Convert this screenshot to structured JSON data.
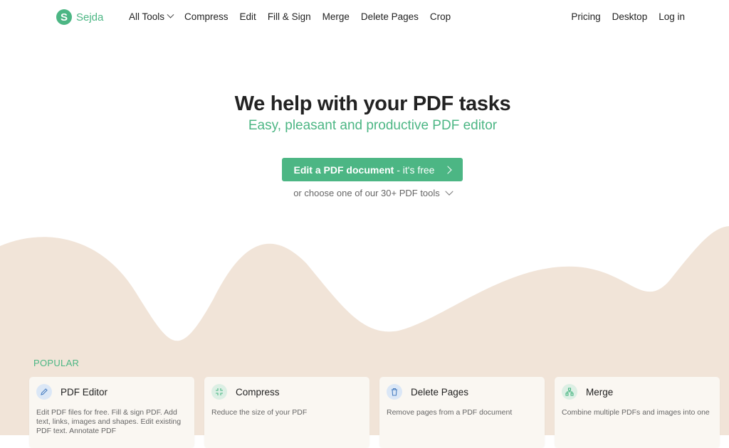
{
  "brand": {
    "logo_letter": "S",
    "name": "Sejda",
    "color": "#4cb684"
  },
  "nav": {
    "left": [
      {
        "label": "All Tools",
        "dropdown": true
      },
      {
        "label": "Compress"
      },
      {
        "label": "Edit"
      },
      {
        "label": "Fill & Sign"
      },
      {
        "label": "Merge"
      },
      {
        "label": "Delete Pages"
      },
      {
        "label": "Crop"
      }
    ],
    "right": [
      {
        "label": "Pricing"
      },
      {
        "label": "Desktop"
      },
      {
        "label": "Log in"
      }
    ]
  },
  "hero": {
    "title": "We help with your PDF tasks",
    "subtitle": "Easy, pleasant and productive PDF editor",
    "cta_bold": "Edit a PDF document",
    "cta_rest": " - it's free",
    "choose_text": "or choose one of our 30+ PDF tools"
  },
  "popular": {
    "label": "POPULAR",
    "cards": [
      {
        "title": "PDF Editor",
        "icon": "pencil-icon",
        "desc": "Edit PDF files for free. Fill & sign PDF. Add text, links, images and shapes. Edit existing PDF text. Annotate PDF"
      },
      {
        "title": "Compress",
        "icon": "compress-icon",
        "desc": "Reduce the size of your PDF"
      },
      {
        "title": "Delete Pages",
        "icon": "trash-icon",
        "desc": "Remove pages from a PDF document"
      },
      {
        "title": "Merge",
        "icon": "merge-icon",
        "desc": "Combine multiple PDFs and images into one"
      }
    ]
  },
  "colors": {
    "accent": "#4cb684",
    "wave": "#f1e4d8",
    "card": "#faf7f2"
  }
}
